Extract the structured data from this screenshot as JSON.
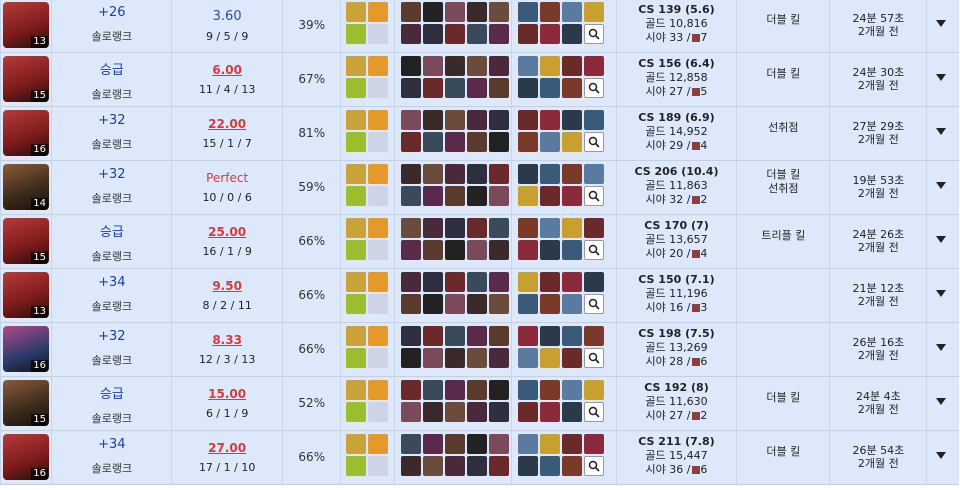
{
  "colors": {
    "row_bg": "#dde9fb",
    "win_blue": "#1f3f9b",
    "kda_red": "#d23c3c"
  },
  "matches": [
    {
      "champion_level": "13",
      "result": "+26",
      "queue": "솔로랭크",
      "kda_ratio": "3.60",
      "kda_style": "blue",
      "kda": "9 / 5 / 9",
      "kill_participation": "39%",
      "cs": "CS 139 (5.6)",
      "gold": "골드 10,816",
      "vision": "시야 33 /",
      "wards": "7",
      "badges": [
        "더블 킬"
      ],
      "duration": "24분 57초",
      "ago": "2개월 전"
    },
    {
      "champion_level": "15",
      "result": "승급",
      "queue": "솔로랭크",
      "kda_ratio": "6.00",
      "kda_style": "red",
      "kda": "11 / 4 / 13",
      "kill_participation": "67%",
      "cs": "CS 156 (6.4)",
      "gold": "골드 12,858",
      "vision": "시야 27 /",
      "wards": "5",
      "badges": [
        "더블 킬"
      ],
      "duration": "24분 30초",
      "ago": "2개월 전"
    },
    {
      "champion_level": "16",
      "result": "+32",
      "queue": "솔로랭크",
      "kda_ratio": "22.00",
      "kda_style": "red",
      "kda": "15 / 1 / 7",
      "kill_participation": "81%",
      "cs": "CS 189 (6.9)",
      "gold": "골드 14,952",
      "vision": "시야 29 /",
      "wards": "4",
      "badges": [
        "선취점"
      ],
      "duration": "27분 29초",
      "ago": "2개월 전"
    },
    {
      "champion_level": "14",
      "result": "+32",
      "queue": "솔로랭크",
      "kda_ratio": "Perfect",
      "kda_style": "perfect",
      "kda": "10 / 0 / 6",
      "kill_participation": "59%",
      "cs": "CS 206 (10.4)",
      "gold": "골드 11,863",
      "vision": "시야 32 /",
      "wards": "2",
      "badges": [
        "더블 킬",
        "선취점"
      ],
      "duration": "19분 53초",
      "ago": "2개월 전"
    },
    {
      "champion_level": "15",
      "result": "승급",
      "queue": "솔로랭크",
      "kda_ratio": "25.00",
      "kda_style": "red",
      "kda": "16 / 1 / 9",
      "kill_participation": "66%",
      "cs": "CS 170 (7)",
      "gold": "골드 13,657",
      "vision": "시야 20 /",
      "wards": "4",
      "badges": [
        "트리플 킬"
      ],
      "duration": "24분 26초",
      "ago": "2개월 전"
    },
    {
      "champion_level": "13",
      "result": "+34",
      "queue": "솔로랭크",
      "kda_ratio": "9.50",
      "kda_style": "red",
      "kda": "8 / 2 / 11",
      "kill_participation": "66%",
      "cs": "CS 150 (7.1)",
      "gold": "골드 11,196",
      "vision": "시야 16 /",
      "wards": "3",
      "badges": [],
      "duration": "21분 12초",
      "ago": "2개월 전"
    },
    {
      "champion_level": "16",
      "result": "+32",
      "queue": "솔로랭크",
      "kda_ratio": "8.33",
      "kda_style": "red",
      "kda": "12 / 3 / 13",
      "kill_participation": "66%",
      "cs": "CS 198 (7.5)",
      "gold": "골드 13,269",
      "vision": "시야 28 /",
      "wards": "6",
      "badges": [],
      "duration": "26분 16초",
      "ago": "2개월 전"
    },
    {
      "champion_level": "15",
      "result": "승급",
      "queue": "솔로랭크",
      "kda_ratio": "15.00",
      "kda_style": "red",
      "kda": "6 / 1 / 9",
      "kill_participation": "52%",
      "cs": "CS 192 (8)",
      "gold": "골드 11,630",
      "vision": "시야 27 /",
      "wards": "2",
      "badges": [
        "더블 킬"
      ],
      "duration": "24분 4초",
      "ago": "2개월 전"
    },
    {
      "champion_level": "16",
      "result": "+34",
      "queue": "솔로랭크",
      "kda_ratio": "27.00",
      "kda_style": "red",
      "kda": "17 / 1 / 10",
      "kill_participation": "66%",
      "cs": "CS 211 (7.8)",
      "gold": "골드 15,447",
      "vision": "시야 36 /",
      "wards": "6",
      "badges": [
        "더블 킬"
      ],
      "duration": "26분 54초",
      "ago": "2개월 전"
    }
  ]
}
